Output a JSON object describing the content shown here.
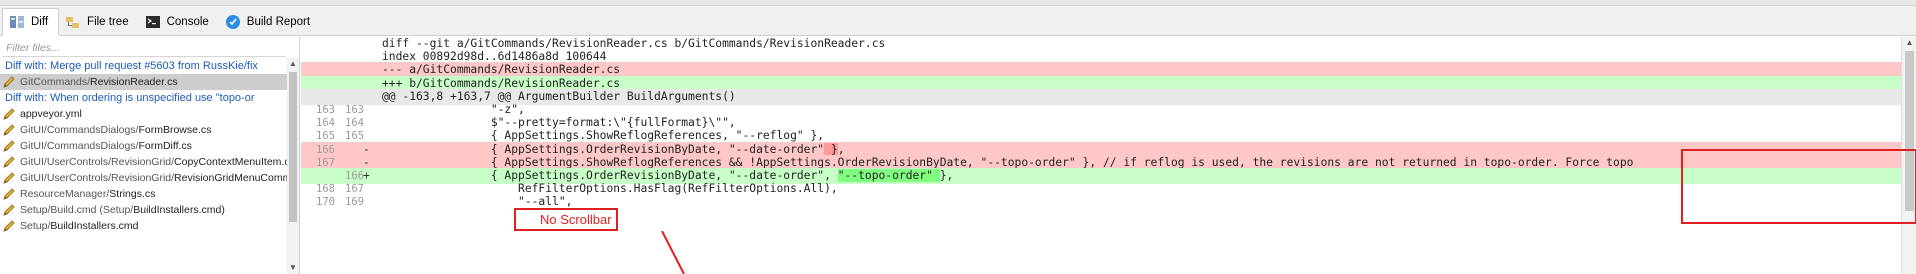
{
  "tabs": [
    {
      "label": "Diff",
      "icon": "diff-icon",
      "active": true
    },
    {
      "label": "File tree",
      "icon": "file-tree-icon",
      "active": false
    },
    {
      "label": "Console",
      "icon": "console-icon",
      "active": false
    },
    {
      "label": "Build Report",
      "icon": "build-report-icon",
      "active": false
    }
  ],
  "filter": {
    "placeholder": "Filter files..."
  },
  "files": [
    {
      "type": "header",
      "text": "Diff with: Merge pull request #5603 from RussKie/fix"
    },
    {
      "type": "file",
      "dir": "GitCommands/",
      "name": "RevisionReader.cs",
      "selected": true
    },
    {
      "type": "header",
      "text": "Diff with: When ordering is unspecified use \"topo-or"
    },
    {
      "type": "file",
      "dir": "",
      "name": "appveyor.yml"
    },
    {
      "type": "file",
      "dir": "GitUI/CommandsDialogs/",
      "name": "FormBrowse.cs"
    },
    {
      "type": "file",
      "dir": "GitUI/CommandsDialogs/",
      "name": "FormDiff.cs"
    },
    {
      "type": "file",
      "dir": "GitUI/UserControls/RevisionGrid/",
      "name": "CopyContextMenuItem.cs"
    },
    {
      "type": "file",
      "dir": "GitUI/UserControls/RevisionGrid/",
      "name": "RevisionGridMenuComm"
    },
    {
      "type": "file",
      "dir": "ResourceManager/",
      "name": "Strings.cs"
    },
    {
      "type": "file",
      "dir": "Setup/Build.cmd (Setup/",
      "name": "BuildInstallers.cmd)"
    },
    {
      "type": "file",
      "dir": "Setup/",
      "name": "BuildInstallers.cmd"
    }
  ],
  "diff": [
    {
      "kind": "meta",
      "old": "",
      "new": "",
      "mark": "",
      "pre": "diff --git a/GitCommands/RevisionReader.cs b/GitCommands/RevisionReader.cs",
      "hl": "",
      "post": ""
    },
    {
      "kind": "meta",
      "old": "",
      "new": "",
      "mark": "",
      "pre": "index 00892d98d..6d1486a8d 100644",
      "hl": "",
      "post": ""
    },
    {
      "kind": "del-head",
      "old": "",
      "new": "",
      "mark": "",
      "pre": "--- a/GitCommands/RevisionReader.cs",
      "hl": "",
      "post": ""
    },
    {
      "kind": "add-head",
      "old": "",
      "new": "",
      "mark": "",
      "pre": "+++ b/GitCommands/RevisionReader.cs",
      "hl": "",
      "post": ""
    },
    {
      "kind": "hunk",
      "old": "",
      "new": "",
      "mark": "",
      "pre": "@@ -163,8 +163,7 @@ ArgumentBuilder BuildArguments()",
      "hl": "",
      "post": ""
    },
    {
      "kind": "ctx",
      "old": "163",
      "new": "163",
      "mark": "",
      "pre": "                \"-z\",",
      "hl": "",
      "post": ""
    },
    {
      "kind": "ctx",
      "old": "164",
      "new": "164",
      "mark": "",
      "pre": "                $\"--pretty=format:\\\"{fullFormat}\\\"\",",
      "hl": "",
      "post": ""
    },
    {
      "kind": "ctx",
      "old": "165",
      "new": "165",
      "mark": "",
      "pre": "                { AppSettings.ShowReflogReferences, \"--reflog\" },",
      "hl": "",
      "post": ""
    },
    {
      "kind": "del",
      "old": "166",
      "new": "",
      "mark": "-",
      "pre": "                { AppSettings.OrderRevisionByDate, \"--date-order\"",
      "hl": " }",
      "post": ","
    },
    {
      "kind": "del",
      "old": "167",
      "new": "",
      "mark": "-",
      "pre": "                { AppSettings.ShowReflogReferences && !AppSettings.OrderRevisionByDate, \"--topo-order\" }, // if reflog is used, the revisions are not returned in topo-order. Force topo",
      "hl": "",
      "post": ""
    },
    {
      "kind": "add",
      "old": "",
      "new": "166",
      "mark": "+",
      "pre": "                { AppSettings.OrderRevisionByDate, \"--date-order\", ",
      "hl": "\"--topo-order\" ",
      "post": "},"
    },
    {
      "kind": "ctx",
      "old": "168",
      "new": "167",
      "mark": "",
      "pre": "                    RefFilterOptions.HasFlag(RefFilterOptions.All),",
      "hl": "",
      "post": ""
    },
    {
      "kind": "ctx",
      "old": "170",
      "new": "169",
      "mark": "",
      "pre": "                    \"--all\",",
      "hl": "",
      "post": ""
    }
  ],
  "annotations": {
    "label": "No Scrollbar",
    "color": "#e02020"
  },
  "colors": {
    "del_bg": "#ffc8c8",
    "add_bg": "#c8ffc8",
    "hunk_bg": "#e8e8e8",
    "header_link": "#1c5cb7"
  }
}
